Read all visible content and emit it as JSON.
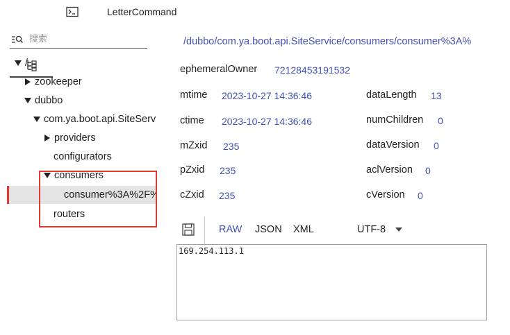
{
  "tabs": {
    "tree_icon": "tree-icon",
    "terminal_icon": "terminal-icon",
    "letter_label": "LetterCommand"
  },
  "search": {
    "placeholder": "搜索",
    "icon": "search-filter-icon"
  },
  "tree": {
    "root": "/",
    "zookeeper": "zookeeper",
    "dubbo": "dubbo",
    "service": "com.ya.boot.api.SiteServ",
    "providers": "providers",
    "configurators": "configurators",
    "consumers": "consumers",
    "consumer_node": "consumer%3A%2F%",
    "routers": "routers"
  },
  "detail": {
    "path": "/dubbo/com.ya.boot.api.SiteService/consumers/consumer%3A%",
    "ephemeralOwner_label": "ephemeralOwner",
    "ephemeralOwner_value": "72128453191532",
    "mtime_label": "mtime",
    "mtime_value": "2023-10-27 14:36:46",
    "ctime_label": "ctime",
    "ctime_value": "2023-10-27 14:36:46",
    "mZxid_label": "mZxid",
    "mZxid_value": "235",
    "pZxid_label": "pZxid",
    "pZxid_value": "235",
    "cZxid_label": "cZxid",
    "cZxid_value": "235",
    "dataLength_label": "dataLength",
    "dataLength_value": "13",
    "numChildren_label": "numChildren",
    "numChildren_value": "0",
    "dataVersion_label": "dataVersion",
    "dataVersion_value": "0",
    "aclVersion_label": "aclVersion",
    "aclVersion_value": "0",
    "cVersion_label": "cVersion",
    "cVersion_value": "0"
  },
  "editor": {
    "save_icon": "save-icon",
    "format_raw": "RAW",
    "format_json": "JSON",
    "format_xml": "XML",
    "charset": "UTF-8",
    "content": "169.254.113.1"
  },
  "colors": {
    "accent": "#3f51b5",
    "highlight_box": "#e53935",
    "selected_row": "#e4e4e4"
  }
}
